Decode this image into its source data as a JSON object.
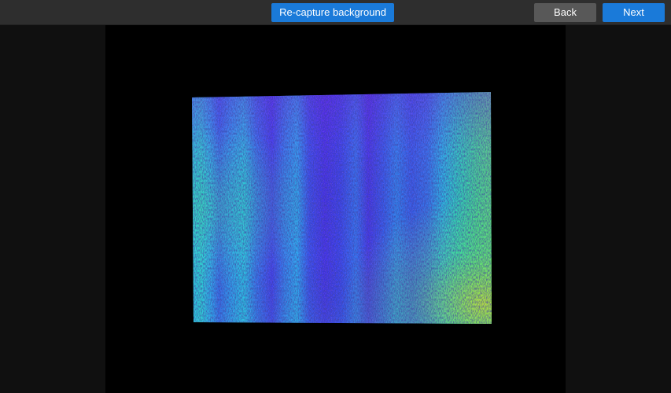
{
  "toolbar": {
    "recapture_label": "Re-capture background",
    "back_label": "Back",
    "next_label": "Next"
  },
  "colors": {
    "primary_button": "#1a7ad9",
    "secondary_button": "#585858",
    "toolbar_bg": "#2e2e2e",
    "viewport_bg": "#000000",
    "side_bg": "#101010"
  },
  "viewer": {
    "content": "depth-map-point-cloud",
    "colormap": "jet"
  }
}
